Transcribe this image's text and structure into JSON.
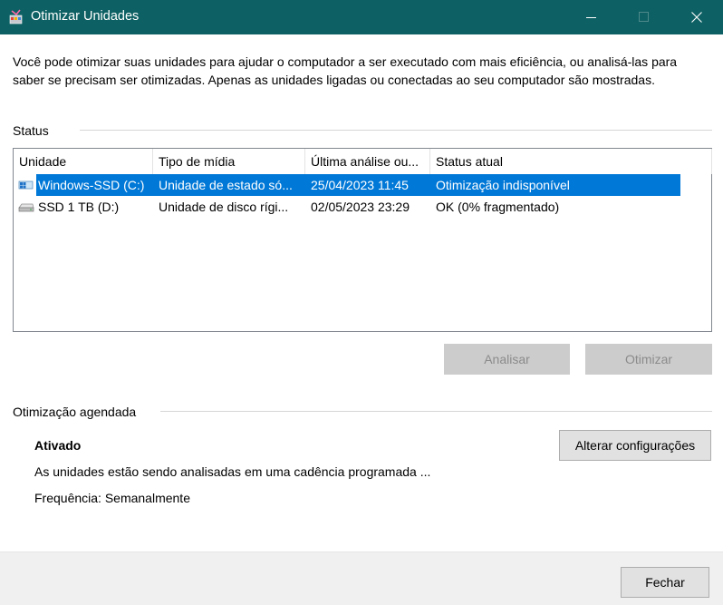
{
  "window": {
    "title": "Otimizar Unidades",
    "icon": "defrag-app-icon",
    "controls": [
      "minimize-icon",
      "maximize-icon",
      "close-icon"
    ]
  },
  "description": "Você pode otimizar suas unidades para ajudar o computador a ser executado com mais eficiência, ou analisá-las para saber se precisam ser otimizadas. Apenas as unidades ligadas ou conectadas ao seu computador são mostradas.",
  "status_section": {
    "label": "Status",
    "columns": [
      "Unidade",
      "Tipo de mídia",
      "Última análise ou...",
      "Status atual"
    ],
    "rows": [
      {
        "icon": "ssd-drive-icon",
        "drive": "Windows-SSD (C:)",
        "media_type": "Unidade de estado só...",
        "last_run": "25/04/2023 11:45",
        "status": "Otimização indisponível",
        "selected": true
      },
      {
        "icon": "hard-drive-icon",
        "drive": "SSD 1 TB (D:)",
        "media_type": "Unidade de disco rígi...",
        "last_run": "02/05/2023 23:29",
        "status": "OK (0% fragmentado)",
        "selected": false
      }
    ]
  },
  "actions": {
    "analyze_label": "Analisar",
    "optimize_label": "Otimizar"
  },
  "scheduled": {
    "label": "Otimização agendada",
    "state": "Ativado",
    "detail": "As unidades estão sendo analisadas em uma cadência programada ...",
    "frequency": "Frequência: Semanalmente",
    "change_settings_label": "Alterar configurações"
  },
  "footer": {
    "close_label": "Fechar"
  },
  "colors": {
    "titlebar": "#0d6063",
    "selection": "#0078d7"
  }
}
